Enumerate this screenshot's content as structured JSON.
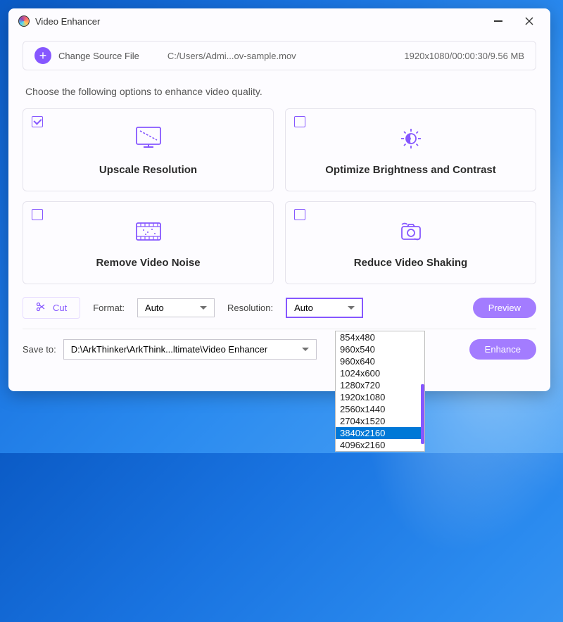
{
  "window": {
    "title": "Video Enhancer"
  },
  "source": {
    "change_label": "Change Source File",
    "path": "C:/Users/Admi...ov-sample.mov",
    "meta": "1920x1080/00:00:30/9.56 MB"
  },
  "instructions": "Choose the following options to enhance video quality.",
  "options": [
    {
      "label": "Upscale Resolution",
      "checked": true
    },
    {
      "label": "Optimize Brightness and Contrast",
      "checked": false
    },
    {
      "label": "Remove Video Noise",
      "checked": false
    },
    {
      "label": "Reduce Video Shaking",
      "checked": false
    }
  ],
  "controls": {
    "cut_label": "Cut",
    "format_label": "Format:",
    "format_value": "Auto",
    "resolution_label": "Resolution:",
    "resolution_value": "Auto",
    "preview_label": "Preview",
    "enhance_label": "Enhance",
    "save_label": "Save to:",
    "save_path": "D:\\ArkThinker\\ArkThink...ltimate\\Video Enhancer"
  },
  "resolution_dropdown": {
    "items": [
      "854x480",
      "960x540",
      "960x640",
      "1024x600",
      "1280x720",
      "1920x1080",
      "2560x1440",
      "2704x1520",
      "3840x2160",
      "4096x2160"
    ],
    "highlighted_index": 8
  },
  "colors": {
    "accent": "#8657ff"
  }
}
